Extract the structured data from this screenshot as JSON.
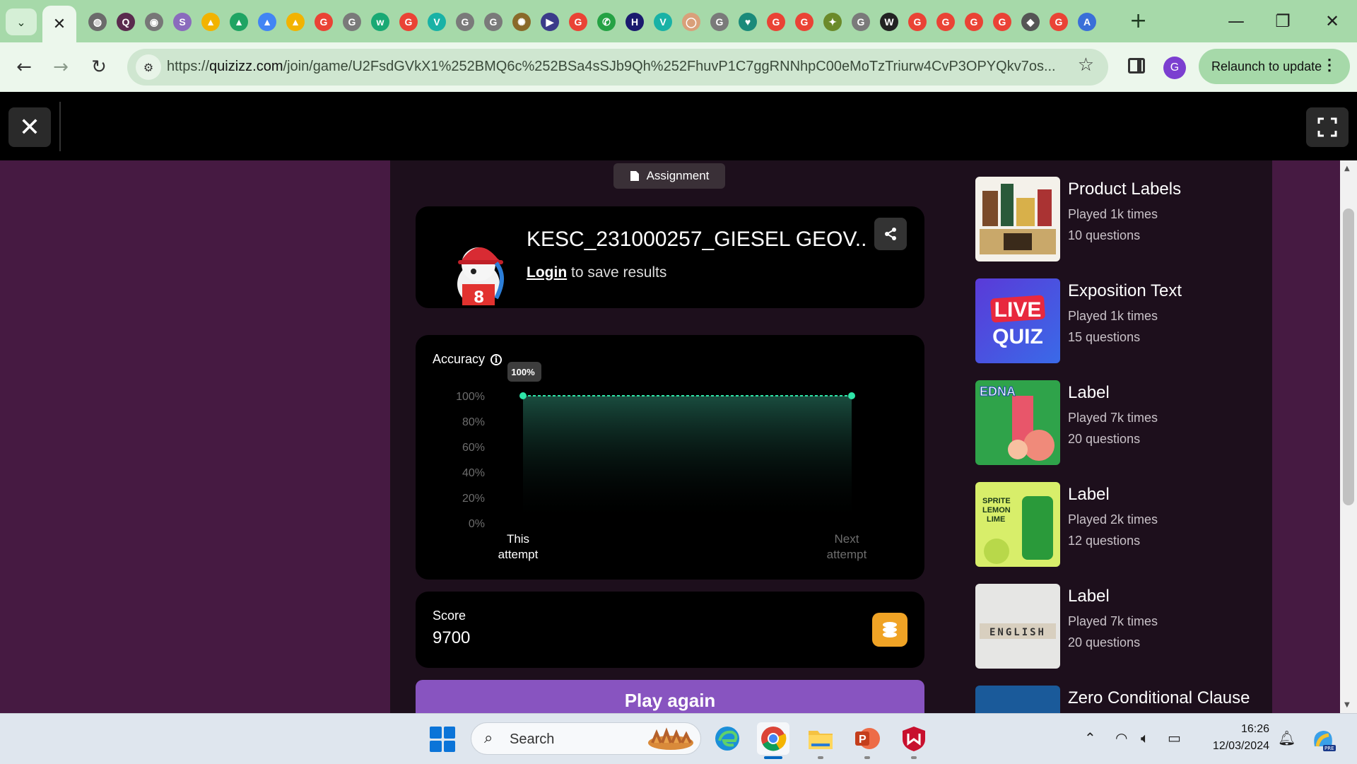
{
  "browser": {
    "url_prefix": "https://",
    "url_host": "quizizz.com",
    "url_path": "/join/game/U2FsdGVkX1%252BMQ6c%252BSa4sSJb9Qh%252FhuvP1C7ggRNNhpC00eMoTzTriurw4CvP3OPYQkv7os...",
    "profile_initial": "G",
    "relaunch_label": "Relaunch to update",
    "tab_icons": [
      {
        "icon": "globe-icon",
        "color": "#6b6b6b",
        "glyph": "◍"
      },
      {
        "icon": "q-icon",
        "color": "#5a2a4e",
        "glyph": "Q"
      },
      {
        "icon": "chrome-icon",
        "color": "#777777",
        "glyph": "◉"
      },
      {
        "icon": "stack-icon",
        "color": "#8a6bbd",
        "glyph": "S"
      },
      {
        "icon": "drive-icon",
        "color": "#f2b300",
        "glyph": "▲"
      },
      {
        "icon": "drive-icon",
        "color": "#1fa463",
        "glyph": "▲"
      },
      {
        "icon": "drive-icon",
        "color": "#4285f4",
        "glyph": "▲"
      },
      {
        "icon": "drive-icon",
        "color": "#f2b300",
        "glyph": "▲"
      },
      {
        "icon": "google-icon",
        "color": "#ea4335",
        "glyph": "G"
      },
      {
        "icon": "google-icon",
        "color": "#7a7a7a",
        "glyph": "G"
      },
      {
        "icon": "tw-icon",
        "color": "#19a974",
        "glyph": "w"
      },
      {
        "icon": "google-icon",
        "color": "#ea4335",
        "glyph": "G"
      },
      {
        "icon": "v-icon",
        "color": "#19b2a6",
        "glyph": "V"
      },
      {
        "icon": "google-icon",
        "color": "#7a7a7a",
        "glyph": "G"
      },
      {
        "icon": "google-icon",
        "color": "#7a7a7a",
        "glyph": "G"
      },
      {
        "icon": "seal-icon",
        "color": "#8a6a2a",
        "glyph": "✺"
      },
      {
        "icon": "arrow-icon",
        "color": "#3b3b8a",
        "glyph": "▶"
      },
      {
        "icon": "google-icon",
        "color": "#ea4335",
        "glyph": "G"
      },
      {
        "icon": "phone-icon",
        "color": "#25a244",
        "glyph": "✆"
      },
      {
        "icon": "hp-icon",
        "color": "#1a1a6e",
        "glyph": "H"
      },
      {
        "icon": "v-icon",
        "color": "#19b2a6",
        "glyph": "V"
      },
      {
        "icon": "egg-icon",
        "color": "#d9a07a",
        "glyph": "◯"
      },
      {
        "icon": "google-icon",
        "color": "#7a7a7a",
        "glyph": "G"
      },
      {
        "icon": "heart-icon",
        "color": "#1a8a7a",
        "glyph": "♥"
      },
      {
        "icon": "google-icon",
        "color": "#ea4335",
        "glyph": "G"
      },
      {
        "icon": "google-icon",
        "color": "#ea4335",
        "glyph": "G"
      },
      {
        "icon": "compass-icon",
        "color": "#6b8a2a",
        "glyph": "✦"
      },
      {
        "icon": "google-icon",
        "color": "#7a7a7a",
        "glyph": "G"
      },
      {
        "icon": "wikipedia-icon",
        "color": "#222222",
        "glyph": "W"
      },
      {
        "icon": "google-icon",
        "color": "#ea4335",
        "glyph": "G"
      },
      {
        "icon": "google-icon",
        "color": "#ea4335",
        "glyph": "G"
      },
      {
        "icon": "google-icon",
        "color": "#ea4335",
        "glyph": "G"
      },
      {
        "icon": "google-icon",
        "color": "#ea4335",
        "glyph": "G"
      },
      {
        "icon": "graduation-icon",
        "color": "#555555",
        "glyph": "◆"
      },
      {
        "icon": "google-icon",
        "color": "#ea4335",
        "glyph": "G"
      },
      {
        "icon": "font-a-icon",
        "color": "#3a6fd8",
        "glyph": "A"
      }
    ]
  },
  "quiz": {
    "assignment_label": "Assignment",
    "player_name": "KESC_231000257_GIESEL GEOV...",
    "login_link": "Login",
    "login_suffix": " to save results",
    "accuracy_label": "Accuracy",
    "score_label": "Score",
    "score_value": "9700",
    "play_again": "Play again"
  },
  "chart_data": {
    "type": "line",
    "title": "Accuracy",
    "x": [
      "This attempt",
      "Next attempt"
    ],
    "series": [
      {
        "values": [
          100,
          100
        ]
      }
    ],
    "point_label": "100%",
    "y_ticks": [
      "100%",
      "80%",
      "60%",
      "40%",
      "20%",
      "0%"
    ],
    "ylim": [
      0,
      100
    ],
    "color": "#2ee6a8"
  },
  "recommendations": [
    {
      "title": "Product Labels",
      "played": "Played 1k times",
      "questions": "10 questions",
      "thumb": "product-labels-thumb"
    },
    {
      "title": "Exposition Text",
      "played": "Played 1k times",
      "questions": "15 questions",
      "thumb": "live-quiz-thumb",
      "thumb_text_1": "LIVE",
      "thumb_text_2": "QUIZ"
    },
    {
      "title": "Label",
      "played": "Played 7k times",
      "questions": "20 questions",
      "thumb": "edna-label-thumb",
      "thumb_text_1": "EDNA"
    },
    {
      "title": "Label",
      "played": "Played 2k times",
      "questions": "12 questions",
      "thumb": "sprite-label-thumb",
      "thumb_text_1": "SPRITE",
      "thumb_text_2": "LEMON",
      "thumb_text_3": "LIME"
    },
    {
      "title": "Label",
      "played": "Played 7k times",
      "questions": "20 questions",
      "thumb": "english-tiles-thumb",
      "thumb_text_1": "ENGLISH"
    },
    {
      "title": "Zero Conditional Clause",
      "played": "",
      "questions": "",
      "thumb": "zero-conditional-thumb"
    }
  ],
  "taskbar": {
    "search_placeholder": "Search",
    "time": "16:26",
    "date": "12/03/2024"
  }
}
